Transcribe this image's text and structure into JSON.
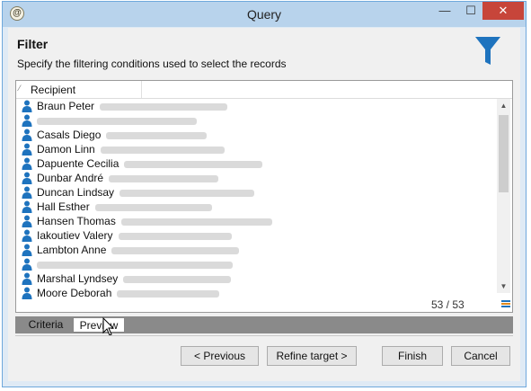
{
  "window": {
    "title": "Query",
    "minimize_glyph": "—",
    "maximize_glyph": "☐",
    "close_glyph": "✕"
  },
  "header": {
    "title": "Filter",
    "description": "Specify the filtering conditions used to select the records"
  },
  "grid": {
    "sort_glyph": "⁄",
    "column": "Recipient",
    "rows": [
      "Braun Peter",
      "",
      "Casals Diego",
      "Damon Linn",
      "Dapuente Cecilia",
      "Dunbar André",
      "Duncan Lindsay",
      "Hall Esther",
      "Hansen Thomas",
      "Iakoutiev Valery",
      "Lambton Anne",
      "",
      "Marshal Lyndsey",
      "Moore Deborah"
    ],
    "count": "53 / 53"
  },
  "tabs": [
    "Criteria",
    "Preview"
  ],
  "buttons": {
    "previous": "< Previous",
    "refine": "Refine target >",
    "finish": "Finish",
    "cancel": "Cancel"
  },
  "colors": {
    "accent": "#1e73be",
    "title_bar": "#b8d3ec",
    "close": "#c7453a"
  }
}
